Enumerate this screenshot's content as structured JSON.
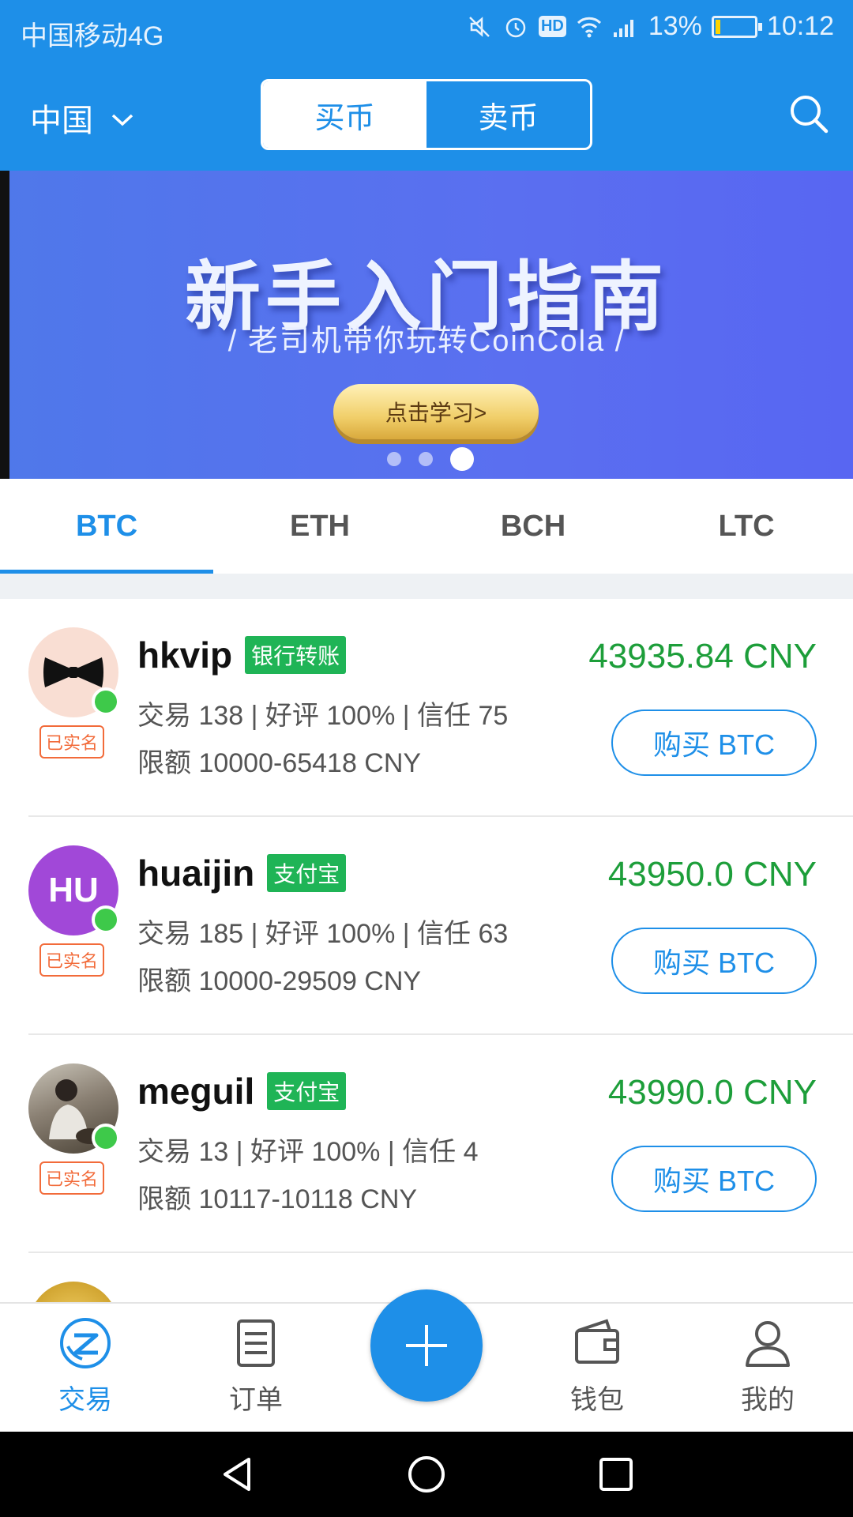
{
  "status_bar": {
    "carrier": "中国移动4G",
    "network": "4G",
    "battery_percent": "13%",
    "time": "10:12",
    "hd_label": "HD"
  },
  "header": {
    "region": "中国",
    "segment": {
      "buy": "买币",
      "sell": "卖币",
      "active": "buy"
    }
  },
  "banner": {
    "title": "新手入门指南",
    "subtitle": "/ 老司机带你玩转CoinCola /",
    "cta": "点击学习>",
    "pages": 3,
    "active_page": 3
  },
  "coin_tabs": [
    "BTC",
    "ETH",
    "BCH",
    "LTC"
  ],
  "active_coin": "BTC",
  "listings": [
    {
      "username": "hkvip",
      "payment": "银行转账",
      "verified": "已实名",
      "stats": "交易 138 | 好评 100% | 信任 75",
      "limit": "限额 10000-65418 CNY",
      "price": "43935.84 CNY",
      "button": "购买 BTC",
      "avatar": "bowtie-avatar"
    },
    {
      "username": "huaijin",
      "payment": "支付宝",
      "verified": "已实名",
      "stats": "交易 185 | 好评 100% | 信任 63",
      "limit": "限额 10000-29509 CNY",
      "price": "43950.0 CNY",
      "button": "购买 BTC",
      "avatar_initials": "HU"
    },
    {
      "username": "meguil",
      "payment": "支付宝",
      "verified": "已实名",
      "stats": "交易 13 | 好评 100% | 信任 4",
      "limit": "限额 10117-10118 CNY",
      "price": "43990.0 CNY",
      "button": "购买 BTC",
      "avatar": "photo-avatar"
    }
  ],
  "bottom_nav": {
    "items": [
      {
        "label": "交易",
        "icon": "trade-icon"
      },
      {
        "label": "订单",
        "icon": "orders-icon"
      },
      {
        "label": "",
        "icon": "plus-icon"
      },
      {
        "label": "钱包",
        "icon": "wallet-icon"
      },
      {
        "label": "我的",
        "icon": "profile-icon"
      }
    ],
    "active": "交易"
  },
  "colors": {
    "primary": "#1e8fe8",
    "price_green": "#1d9e3a",
    "tag_green": "#1fb456",
    "verified_orange": "#f26b3a"
  }
}
